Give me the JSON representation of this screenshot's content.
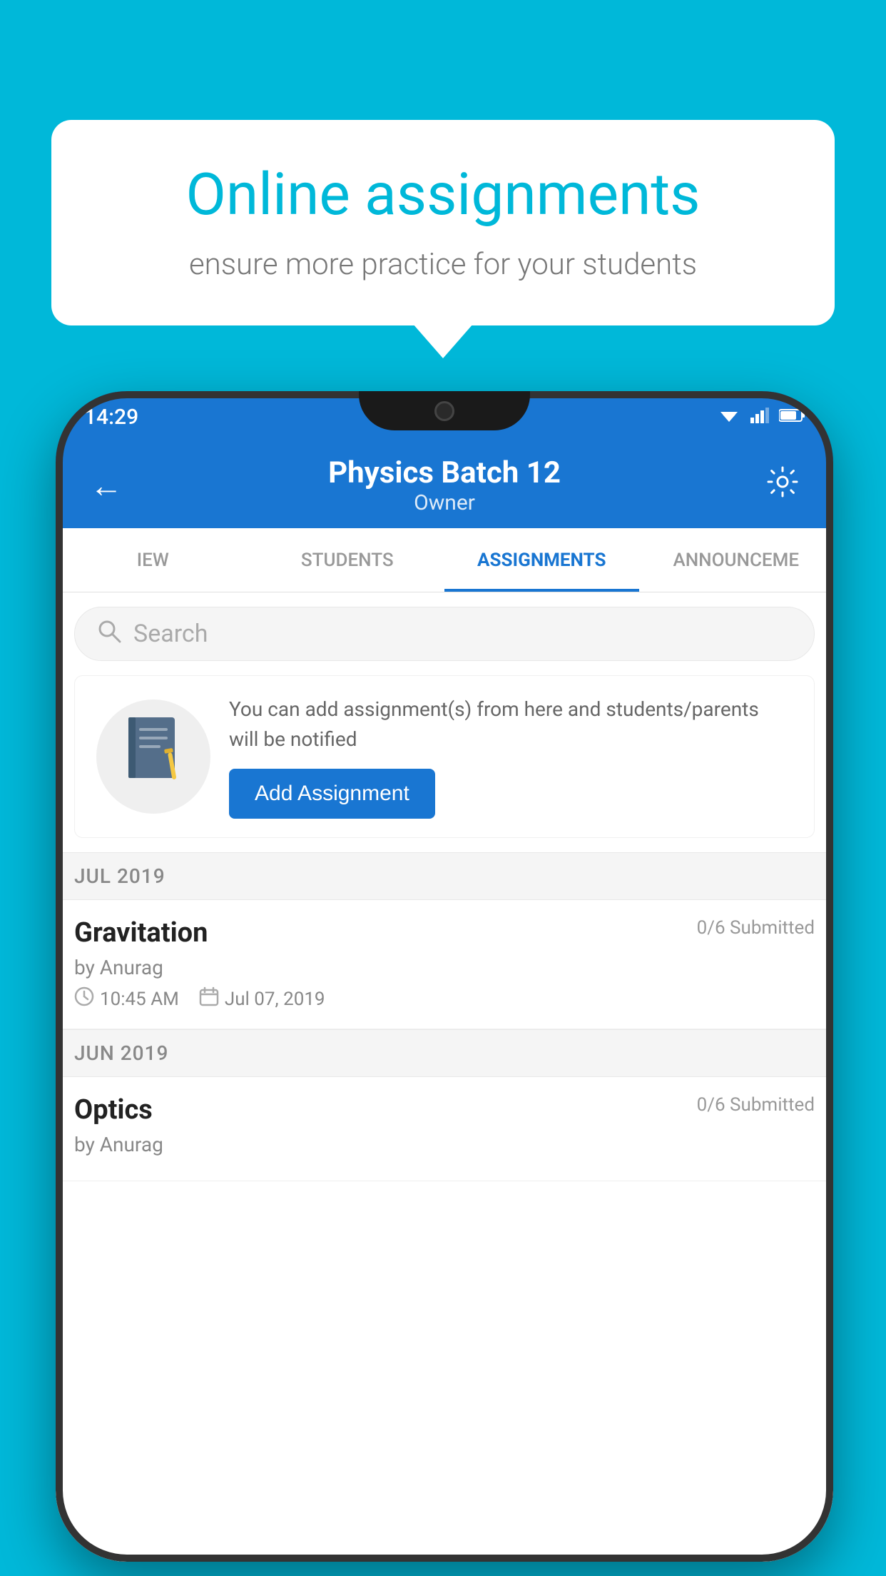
{
  "page": {
    "background_color": "#00b8d9"
  },
  "speech_bubble": {
    "title": "Online assignments",
    "subtitle": "ensure more practice for your students"
  },
  "status_bar": {
    "time": "14:29",
    "wifi": "▲",
    "signal": "◀",
    "battery": "▮"
  },
  "app_bar": {
    "back_label": "←",
    "title": "Physics Batch 12",
    "subtitle": "Owner",
    "settings_label": "⚙"
  },
  "tabs": [
    {
      "label": "IEW",
      "active": false
    },
    {
      "label": "STUDENTS",
      "active": false
    },
    {
      "label": "ASSIGNMENTS",
      "active": true
    },
    {
      "label": "ANNOUNCEMENTS",
      "active": false
    }
  ],
  "search": {
    "placeholder": "Search"
  },
  "promo": {
    "description": "You can add assignment(s) from here and students/parents will be notified",
    "button_label": "Add Assignment"
  },
  "sections": [
    {
      "label": "JUL 2019",
      "assignments": [
        {
          "name": "Gravitation",
          "submitted": "0/6 Submitted",
          "author": "by Anurag",
          "time": "10:45 AM",
          "date": "Jul 07, 2019"
        }
      ]
    },
    {
      "label": "JUN 2019",
      "assignments": [
        {
          "name": "Optics",
          "submitted": "0/6 Submitted",
          "author": "by Anurag",
          "time": "",
          "date": ""
        }
      ]
    }
  ]
}
